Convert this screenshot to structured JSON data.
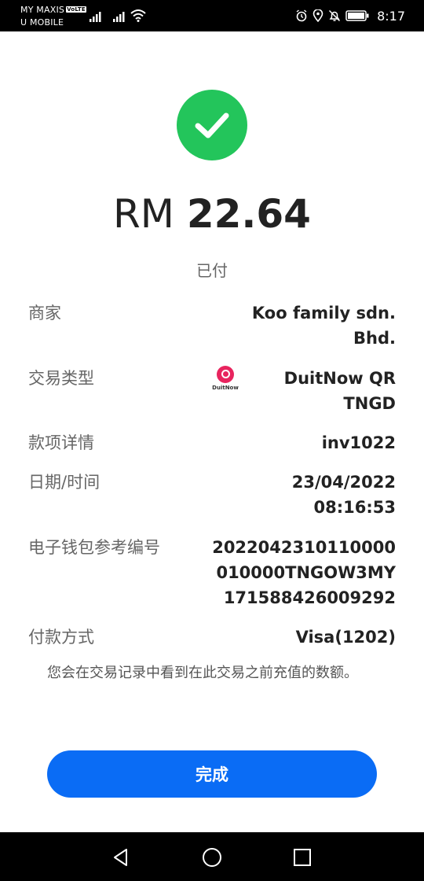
{
  "status_bar": {
    "carrier1": "MY MAXIS",
    "volte": "VoLTE",
    "carrier2": "U MOBILE",
    "time": "8:17",
    "icons": [
      "signal-icon",
      "signal-icon",
      "wifi-icon",
      "alarm-icon",
      "location-icon",
      "bell-off-icon",
      "battery-icon"
    ]
  },
  "receipt": {
    "status_icon": "check-circle-icon",
    "status_color": "#23c55b",
    "currency": "RM",
    "amount": "22.64",
    "status_text": "已付",
    "rows": [
      {
        "label": "商家",
        "value": "Koo family sdn.\nBhd."
      },
      {
        "label": "交易类型",
        "value": "DuitNow QR\nTNGD",
        "logo_text": "DuitNow"
      },
      {
        "label": "款项详情",
        "value": "inv1022"
      },
      {
        "label": "日期/时间",
        "value": "23/04/2022\n08:16:53"
      },
      {
        "label": "电子钱包参考编号",
        "value": "2022042310110000\n010000TNGOW3MY\n171588426009292"
      },
      {
        "label": "付款方式",
        "value": "Visa(1202)"
      }
    ],
    "note": "您会在交易记录中看到在此交易之前充值的数额。"
  },
  "actions": {
    "done_label": "完成",
    "accent_color": "#0a6cf5"
  },
  "nav_bar": {
    "icons": [
      "back-icon",
      "home-icon",
      "recents-icon"
    ]
  }
}
